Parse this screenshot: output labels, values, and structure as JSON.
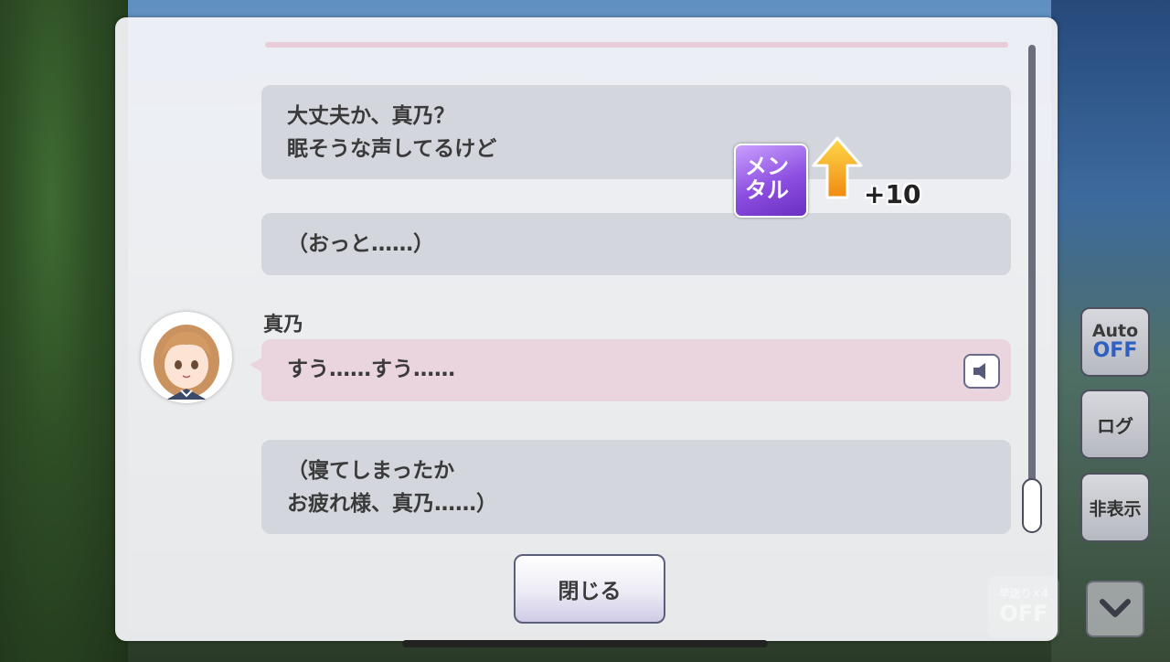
{
  "messages": [
    {
      "lines": [
        "大丈夫か、真乃？",
        "眠そうな声してるけど"
      ]
    },
    {
      "lines": [
        "（おっと……）"
      ]
    },
    {
      "speaker": "真乃",
      "lines": [
        "すう……すう……"
      ]
    },
    {
      "lines": [
        "（寝てしまったか",
        "お疲れ様、真乃……）"
      ]
    }
  ],
  "close_label": "閉じる",
  "status_effect": {
    "badge_lines": [
      "メン",
      "タル"
    ],
    "delta": "+10",
    "icon": "up-arrow-icon"
  },
  "controls": {
    "auto_label": "Auto",
    "auto_state": "OFF",
    "log_label": "ログ",
    "hide_label": "非表示",
    "fast_forward_label": "早送り×4",
    "fast_forward_state": "OFF"
  },
  "colors": {
    "accent": "#2f5fc0",
    "speaker_bubble": "#ead5df",
    "bubble": "#d3d6dd",
    "badge": "#8c4ee0"
  }
}
